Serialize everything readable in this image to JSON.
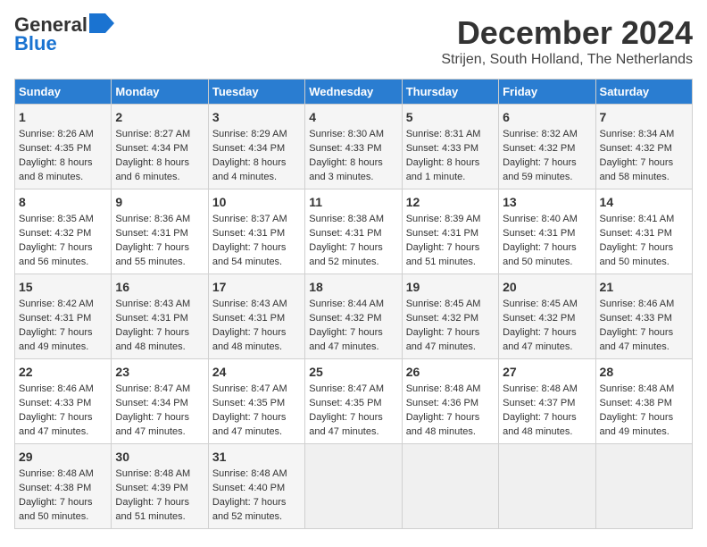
{
  "header": {
    "logo_line1": "General",
    "logo_line2": "Blue",
    "title": "December 2024",
    "subtitle": "Strijen, South Holland, The Netherlands"
  },
  "columns": [
    "Sunday",
    "Monday",
    "Tuesday",
    "Wednesday",
    "Thursday",
    "Friday",
    "Saturday"
  ],
  "weeks": [
    [
      {
        "day": "1",
        "lines": [
          "Sunrise: 8:26 AM",
          "Sunset: 4:35 PM",
          "Daylight: 8 hours",
          "and 8 minutes."
        ]
      },
      {
        "day": "2",
        "lines": [
          "Sunrise: 8:27 AM",
          "Sunset: 4:34 PM",
          "Daylight: 8 hours",
          "and 6 minutes."
        ]
      },
      {
        "day": "3",
        "lines": [
          "Sunrise: 8:29 AM",
          "Sunset: 4:34 PM",
          "Daylight: 8 hours",
          "and 4 minutes."
        ]
      },
      {
        "day": "4",
        "lines": [
          "Sunrise: 8:30 AM",
          "Sunset: 4:33 PM",
          "Daylight: 8 hours",
          "and 3 minutes."
        ]
      },
      {
        "day": "5",
        "lines": [
          "Sunrise: 8:31 AM",
          "Sunset: 4:33 PM",
          "Daylight: 8 hours",
          "and 1 minute."
        ]
      },
      {
        "day": "6",
        "lines": [
          "Sunrise: 8:32 AM",
          "Sunset: 4:32 PM",
          "Daylight: 7 hours",
          "and 59 minutes."
        ]
      },
      {
        "day": "7",
        "lines": [
          "Sunrise: 8:34 AM",
          "Sunset: 4:32 PM",
          "Daylight: 7 hours",
          "and 58 minutes."
        ]
      }
    ],
    [
      {
        "day": "8",
        "lines": [
          "Sunrise: 8:35 AM",
          "Sunset: 4:32 PM",
          "Daylight: 7 hours",
          "and 56 minutes."
        ]
      },
      {
        "day": "9",
        "lines": [
          "Sunrise: 8:36 AM",
          "Sunset: 4:31 PM",
          "Daylight: 7 hours",
          "and 55 minutes."
        ]
      },
      {
        "day": "10",
        "lines": [
          "Sunrise: 8:37 AM",
          "Sunset: 4:31 PM",
          "Daylight: 7 hours",
          "and 54 minutes."
        ]
      },
      {
        "day": "11",
        "lines": [
          "Sunrise: 8:38 AM",
          "Sunset: 4:31 PM",
          "Daylight: 7 hours",
          "and 52 minutes."
        ]
      },
      {
        "day": "12",
        "lines": [
          "Sunrise: 8:39 AM",
          "Sunset: 4:31 PM",
          "Daylight: 7 hours",
          "and 51 minutes."
        ]
      },
      {
        "day": "13",
        "lines": [
          "Sunrise: 8:40 AM",
          "Sunset: 4:31 PM",
          "Daylight: 7 hours",
          "and 50 minutes."
        ]
      },
      {
        "day": "14",
        "lines": [
          "Sunrise: 8:41 AM",
          "Sunset: 4:31 PM",
          "Daylight: 7 hours",
          "and 50 minutes."
        ]
      }
    ],
    [
      {
        "day": "15",
        "lines": [
          "Sunrise: 8:42 AM",
          "Sunset: 4:31 PM",
          "Daylight: 7 hours",
          "and 49 minutes."
        ]
      },
      {
        "day": "16",
        "lines": [
          "Sunrise: 8:43 AM",
          "Sunset: 4:31 PM",
          "Daylight: 7 hours",
          "and 48 minutes."
        ]
      },
      {
        "day": "17",
        "lines": [
          "Sunrise: 8:43 AM",
          "Sunset: 4:31 PM",
          "Daylight: 7 hours",
          "and 48 minutes."
        ]
      },
      {
        "day": "18",
        "lines": [
          "Sunrise: 8:44 AM",
          "Sunset: 4:32 PM",
          "Daylight: 7 hours",
          "and 47 minutes."
        ]
      },
      {
        "day": "19",
        "lines": [
          "Sunrise: 8:45 AM",
          "Sunset: 4:32 PM",
          "Daylight: 7 hours",
          "and 47 minutes."
        ]
      },
      {
        "day": "20",
        "lines": [
          "Sunrise: 8:45 AM",
          "Sunset: 4:32 PM",
          "Daylight: 7 hours",
          "and 47 minutes."
        ]
      },
      {
        "day": "21",
        "lines": [
          "Sunrise: 8:46 AM",
          "Sunset: 4:33 PM",
          "Daylight: 7 hours",
          "and 47 minutes."
        ]
      }
    ],
    [
      {
        "day": "22",
        "lines": [
          "Sunrise: 8:46 AM",
          "Sunset: 4:33 PM",
          "Daylight: 7 hours",
          "and 47 minutes."
        ]
      },
      {
        "day": "23",
        "lines": [
          "Sunrise: 8:47 AM",
          "Sunset: 4:34 PM",
          "Daylight: 7 hours",
          "and 47 minutes."
        ]
      },
      {
        "day": "24",
        "lines": [
          "Sunrise: 8:47 AM",
          "Sunset: 4:35 PM",
          "Daylight: 7 hours",
          "and 47 minutes."
        ]
      },
      {
        "day": "25",
        "lines": [
          "Sunrise: 8:47 AM",
          "Sunset: 4:35 PM",
          "Daylight: 7 hours",
          "and 47 minutes."
        ]
      },
      {
        "day": "26",
        "lines": [
          "Sunrise: 8:48 AM",
          "Sunset: 4:36 PM",
          "Daylight: 7 hours",
          "and 48 minutes."
        ]
      },
      {
        "day": "27",
        "lines": [
          "Sunrise: 8:48 AM",
          "Sunset: 4:37 PM",
          "Daylight: 7 hours",
          "and 48 minutes."
        ]
      },
      {
        "day": "28",
        "lines": [
          "Sunrise: 8:48 AM",
          "Sunset: 4:38 PM",
          "Daylight: 7 hours",
          "and 49 minutes."
        ]
      }
    ],
    [
      {
        "day": "29",
        "lines": [
          "Sunrise: 8:48 AM",
          "Sunset: 4:38 PM",
          "Daylight: 7 hours",
          "and 50 minutes."
        ]
      },
      {
        "day": "30",
        "lines": [
          "Sunrise: 8:48 AM",
          "Sunset: 4:39 PM",
          "Daylight: 7 hours",
          "and 51 minutes."
        ]
      },
      {
        "day": "31",
        "lines": [
          "Sunrise: 8:48 AM",
          "Sunset: 4:40 PM",
          "Daylight: 7 hours",
          "and 52 minutes."
        ]
      },
      null,
      null,
      null,
      null
    ]
  ]
}
